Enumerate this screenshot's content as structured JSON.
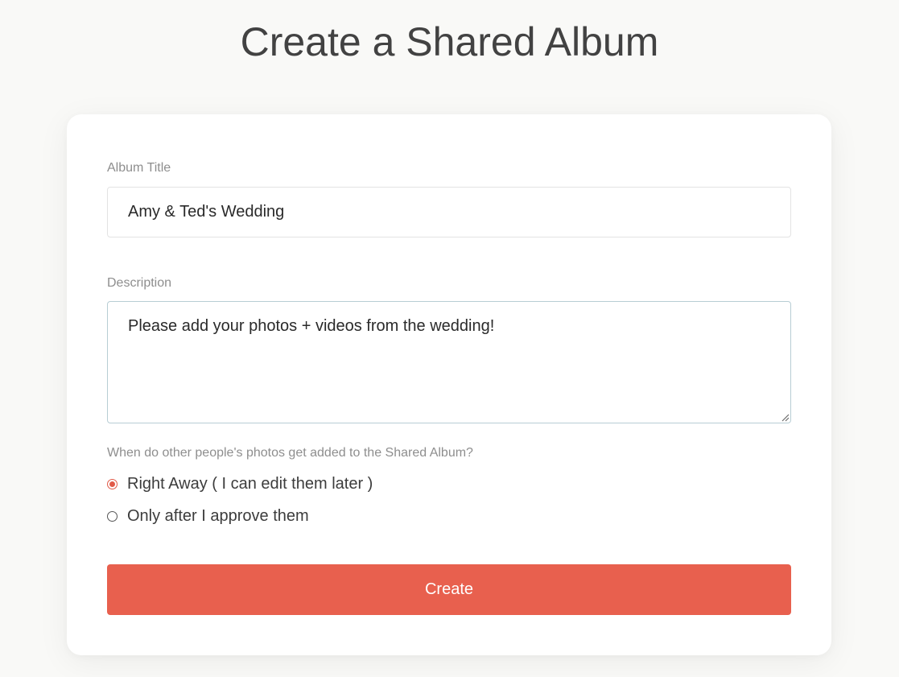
{
  "page": {
    "title": "Create a Shared Album"
  },
  "form": {
    "album_title": {
      "label": "Album Title",
      "value": "Amy & Ted's Wedding"
    },
    "description": {
      "label": "Description",
      "value": "Please add your photos + videos from the wedding!"
    },
    "approval": {
      "question": "When do other people's photos get added to the Shared Album?",
      "options": [
        {
          "label": "Right Away ( I can edit them later )",
          "selected": true
        },
        {
          "label": "Only after I approve them",
          "selected": false
        }
      ]
    },
    "submit_label": "Create"
  },
  "colors": {
    "accent": "#e8604e",
    "background": "#f9f9f7",
    "card": "#ffffff",
    "title_text": "#424242",
    "label_text": "#8e8e8e"
  }
}
